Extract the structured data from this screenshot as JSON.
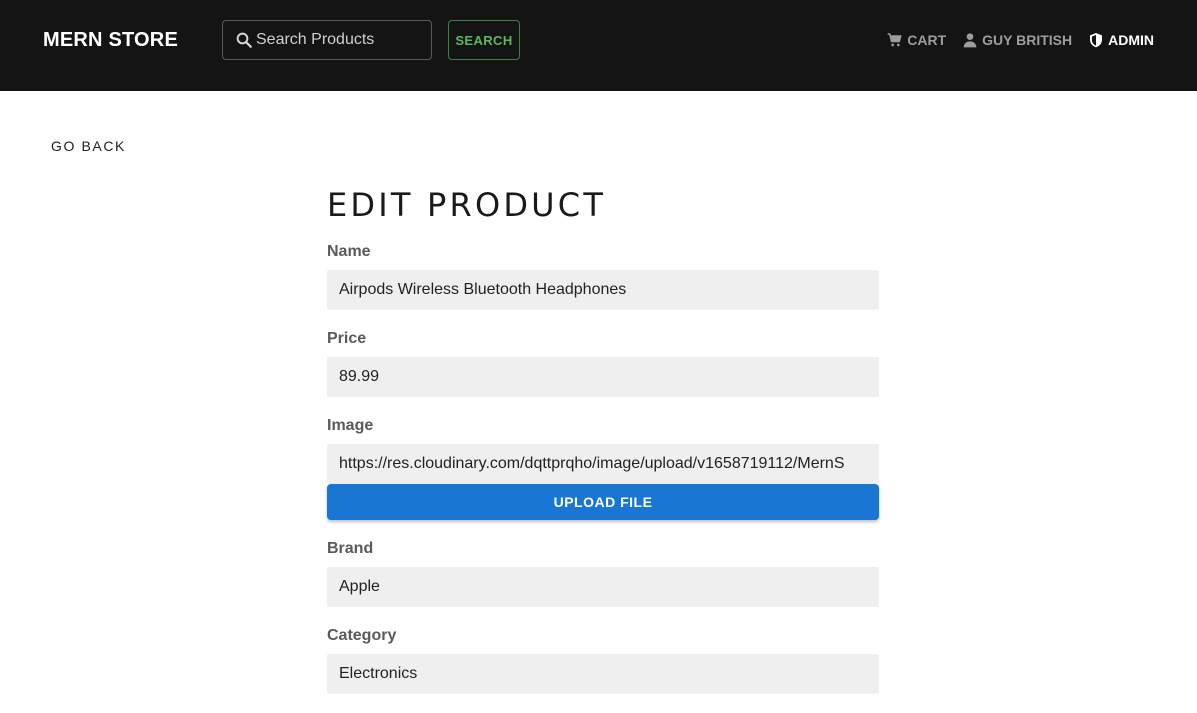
{
  "header": {
    "brand": "MERN STORE",
    "search": {
      "placeholder": "Search Products",
      "value": ""
    },
    "search_button": "SEARCH",
    "nav": {
      "cart": "CART",
      "user": "GUY BRITISH",
      "admin": "ADMIN"
    }
  },
  "main": {
    "go_back": "GO BACK",
    "title": "EDIT PRODUCT",
    "fields": {
      "name": {
        "label": "Name",
        "value": "Airpods Wireless Bluetooth Headphones"
      },
      "price": {
        "label": "Price",
        "value": "89.99"
      },
      "image": {
        "label": "Image",
        "value": "https://res.cloudinary.com/dqttprqho/image/upload/v1658719112/MernS"
      },
      "brand": {
        "label": "Brand",
        "value": "Apple"
      },
      "category": {
        "label": "Category",
        "value": "Electronics"
      }
    },
    "upload_button": "UPLOAD FILE"
  },
  "colors": {
    "navbar": "#141414",
    "accent_green": "#5cb85c",
    "upload_blue": "#1976d2",
    "input_bg": "#efefef"
  },
  "icons": {
    "search": "search-icon",
    "cart": "cart-icon",
    "user": "user-icon",
    "admin": "shield-icon"
  }
}
